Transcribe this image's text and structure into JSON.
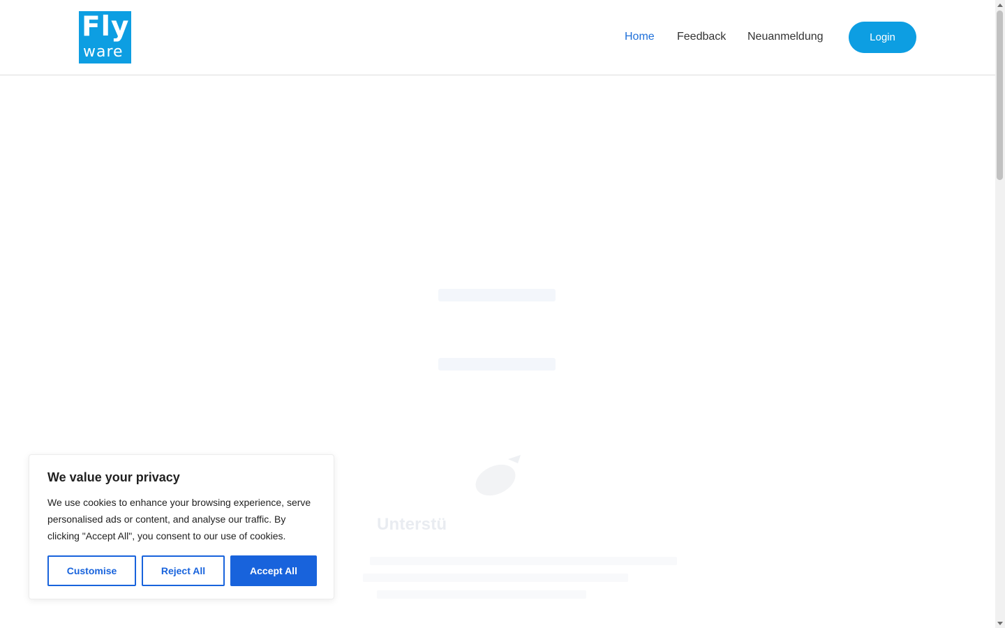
{
  "header": {
    "logo": {
      "line1": "Fly",
      "line2": "ware"
    },
    "nav": [
      {
        "label": "Home",
        "active": true
      },
      {
        "label": "Feedback",
        "active": false
      },
      {
        "label": "Neuanmeldung",
        "active": false
      }
    ],
    "login_label": "Login"
  },
  "background": {
    "heading_fragment": "Unterstü"
  },
  "cookie_banner": {
    "title": "We value your privacy",
    "text": "We use cookies to enhance your browsing experience, serve personalised ads or content, and analyse our traffic. By clicking \"Accept All\", you consent to our use of cookies.",
    "buttons": {
      "customise": "Customise",
      "reject": "Reject All",
      "accept": "Accept All"
    }
  },
  "colors": {
    "brand": "#0d9ee2",
    "nav_active": "#1e6fd9",
    "cookie_accent": "#1863dc"
  },
  "icons": {
    "scroll_up": "triangle-up",
    "scroll_down": "triangle-down"
  }
}
